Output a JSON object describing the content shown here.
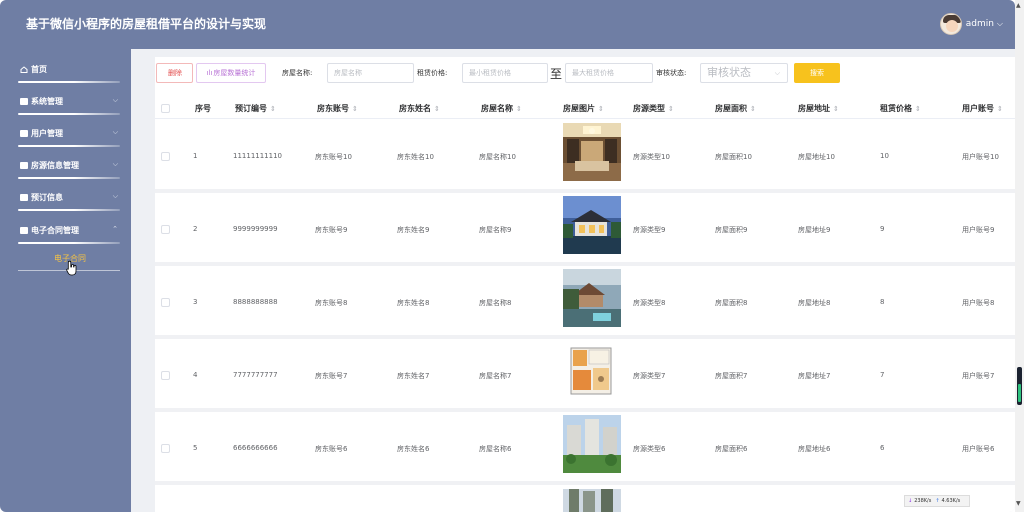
{
  "header": {
    "title": "基于微信小程序的房屋租借平台的设计与实现",
    "user_name": "admin"
  },
  "sidebar": {
    "items": [
      {
        "label": "首页"
      },
      {
        "label": "系统管理"
      },
      {
        "label": "用户管理"
      },
      {
        "label": "房源信息管理"
      },
      {
        "label": "预订信息"
      },
      {
        "label": "电子合同管理"
      }
    ],
    "active_sub": "电子合同"
  },
  "toolbar": {
    "delete_label": "删除",
    "stats_label": "房屋数量统计",
    "name_label": "房屋名称:",
    "name_placeholder": "房屋名称",
    "price_label": "租赁价格:",
    "min_placeholder": "最小租赁价格",
    "to_label": "至",
    "max_placeholder": "最大租赁价格",
    "status_label": "审核状态:",
    "status_placeholder": "审核状态",
    "search_label": "搜索"
  },
  "table": {
    "columns": [
      "序号",
      "预订编号",
      "房东账号",
      "房东姓名",
      "房屋名称",
      "房屋图片",
      "房源类型",
      "房屋面积",
      "房屋地址",
      "租赁价格",
      "用户账号"
    ],
    "rows": [
      {
        "idx": "1",
        "order": "11111111110",
        "account": "房东账号10",
        "landlord": "房东姓名10",
        "house": "房屋名称10",
        "image": "luxury-interior",
        "type": "房源类型10",
        "area": "房屋面积10",
        "address": "房屋地址10",
        "price": "10",
        "user": "用户账号10"
      },
      {
        "idx": "2",
        "order": "9999999999",
        "account": "房东账号9",
        "landlord": "房东姓名9",
        "house": "房屋名称9",
        "image": "chinese-courtyard",
        "type": "房源类型9",
        "area": "房屋面积9",
        "address": "房屋地址9",
        "price": "9",
        "user": "用户账号9"
      },
      {
        "idx": "3",
        "order": "8888888888",
        "account": "房东账号8",
        "landlord": "房东姓名8",
        "house": "房屋名称8",
        "image": "seaside-villa",
        "type": "房源类型8",
        "area": "房屋面积8",
        "address": "房屋地址8",
        "price": "8",
        "user": "用户账号8"
      },
      {
        "idx": "4",
        "order": "7777777777",
        "account": "房东账号7",
        "landlord": "房东姓名7",
        "house": "房屋名称7",
        "image": "floor-plan",
        "type": "房源类型7",
        "area": "房屋面积7",
        "address": "房屋地址7",
        "price": "7",
        "user": "用户账号7"
      },
      {
        "idx": "5",
        "order": "6666666666",
        "account": "房东账号6",
        "landlord": "房东姓名6",
        "house": "房屋名称6",
        "image": "apartment-buildings",
        "type": "房源类型6",
        "area": "房屋面积6",
        "address": "房屋地址6",
        "price": "6",
        "user": "用户账号6"
      }
    ]
  },
  "netspeed": {
    "down": "238K/s",
    "up": "4.63K/s"
  },
  "colors": {
    "sidebar": "#6f7ea4",
    "accent": "#f7c21d",
    "active_sub": "#f5c343",
    "delete": "#e24b4b",
    "stats": "#b974d6"
  }
}
